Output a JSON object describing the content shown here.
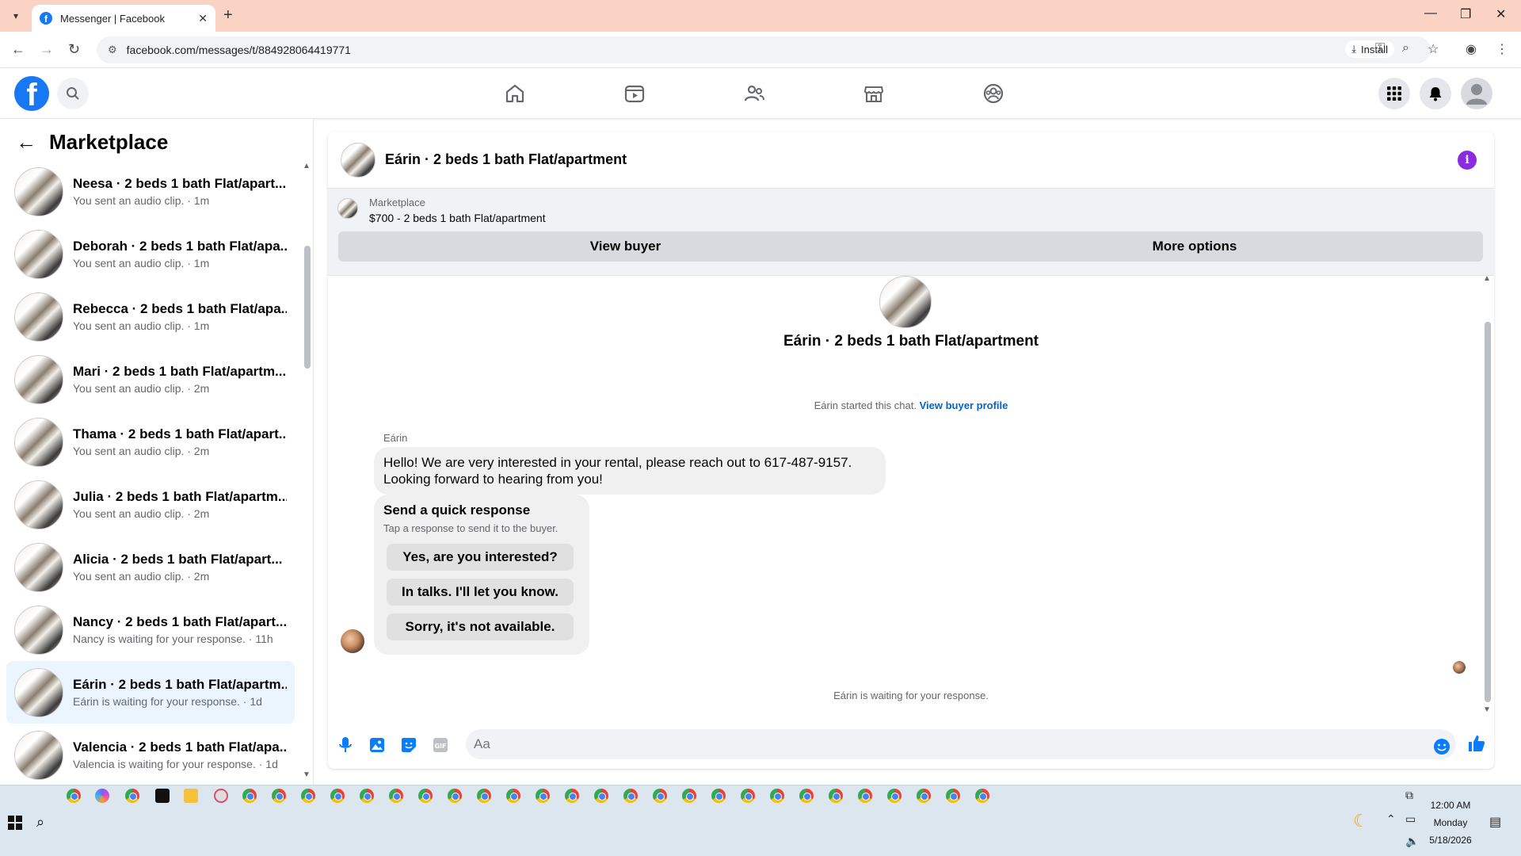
{
  "browser": {
    "tab_title": "Messenger | Facebook",
    "url": "facebook.com/messages/t/884928064419771",
    "install_label": "Install"
  },
  "leftpanel": {
    "title": "Marketplace",
    "conversations": [
      {
        "name": "Neesa · 2 beds 1 bath Flat/apart...",
        "sub": "You sent an audio clip. · 1m"
      },
      {
        "name": "Deborah · 2 beds 1 bath Flat/apa...",
        "sub": "You sent an audio clip. · 1m"
      },
      {
        "name": "Rebecca · 2 beds 1 bath Flat/apa...",
        "sub": "You sent an audio clip. · 1m"
      },
      {
        "name": "Mari · 2 beds 1 bath Flat/apartm...",
        "sub": "You sent an audio clip. · 2m"
      },
      {
        "name": "Thama · 2 beds 1 bath Flat/apart...",
        "sub": "You sent an audio clip. · 2m"
      },
      {
        "name": "Julia · 2 beds 1 bath Flat/apartm...",
        "sub": "You sent an audio clip. · 2m"
      },
      {
        "name": "Alicia · 2 beds 1 bath Flat/apart...",
        "sub": "You sent an audio clip. · 2m"
      },
      {
        "name": "Nancy · 2 beds 1 bath Flat/apart...",
        "sub": "Nancy is waiting for your response. · 11h"
      },
      {
        "name": "Eárin · 2 beds 1 bath Flat/apartm...",
        "sub": "Eárin is waiting for your response. · 1d"
      },
      {
        "name": "Valencia · 2 beds 1 bath Flat/apa...",
        "sub": "Valencia is waiting for your response. · 1d"
      }
    ]
  },
  "chat": {
    "title": "Eárin · 2 beds 1 bath Flat/apartment",
    "marketplace_label": "Marketplace",
    "listing": "$700 - 2 beds 1 bath Flat/apartment",
    "view_buyer": "View buyer",
    "more_options": "More options",
    "center_name": "Eárin · 2 beds 1 bath Flat/apartment",
    "started_text": "Eárin started this chat.",
    "view_buyer_profile": "View buyer profile",
    "sender": "Eárin",
    "message_line1": "Hello! We are very interested in your rental, please reach out to 617-487-9157.",
    "message_line2": "Looking forward to hearing from you!",
    "quick_title": "Send a quick response",
    "quick_sub": "Tap a response to send it to the buyer.",
    "quick_responses": [
      "Yes, are you interested?",
      "In talks. I'll let you know.",
      "Sorry, it's not available."
    ],
    "waiting_text": "Eárin is waiting for your response.",
    "composer_placeholder": "Aa"
  },
  "taskbar": {
    "time": "12:00 AM",
    "day": "Monday",
    "date": "5/18/2026"
  },
  "colors": {
    "fb_blue": "#1877f2",
    "tabbar": "#fbd3c4",
    "active_conv": "#ebf5ff",
    "info_purple": "#8a2be2"
  }
}
